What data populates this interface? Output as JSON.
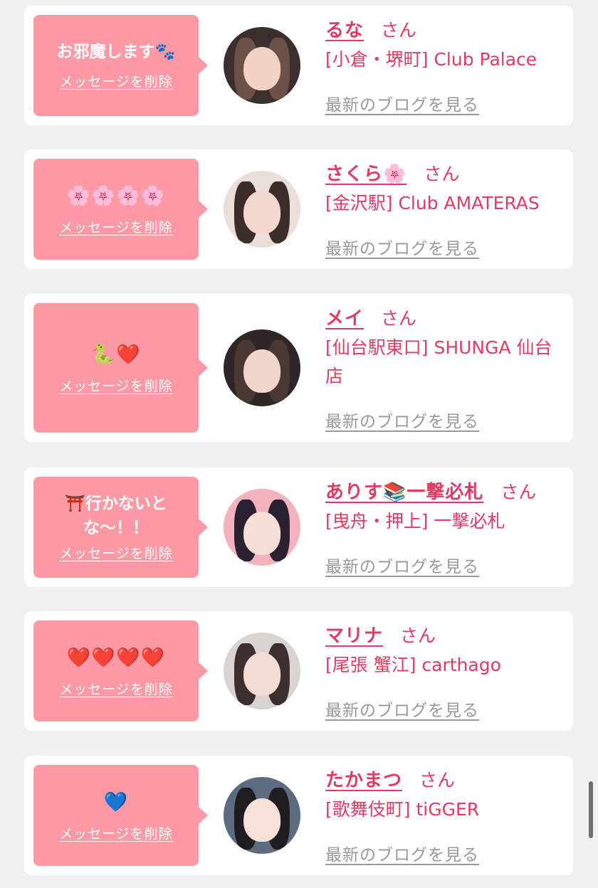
{
  "delete_label": "メッセージを削除",
  "blog_label": "最新のブログを見る",
  "san_label": "さん",
  "colors": {
    "accent": "#e33a63",
    "bubble": "#fd98a5",
    "link_gray": "#999999"
  },
  "cards": [
    {
      "message": "お邪魔します🐾",
      "name": "るな",
      "shop": "[小倉・堺町] Club Palace"
    },
    {
      "message": "🌸🌸🌸🌸",
      "name": "さくら🌸",
      "shop": "[金沢駅] Club AMATERAS"
    },
    {
      "message": "🐍❤️",
      "name": "メイ",
      "shop": "[仙台駅東口] SHUNGA 仙台店"
    },
    {
      "message": "⛩️行かないとな〜！！",
      "name": "ありす📚一撃必札",
      "shop": "[曳舟・押上] 一撃必札"
    },
    {
      "message": "❤️❤️❤️❤️",
      "name": "マリナ",
      "shop": "[尾張 蟹江] carthago"
    },
    {
      "message": "💙",
      "name": "たかまつ",
      "shop": "[歌舞伎町] tiGGER"
    }
  ]
}
